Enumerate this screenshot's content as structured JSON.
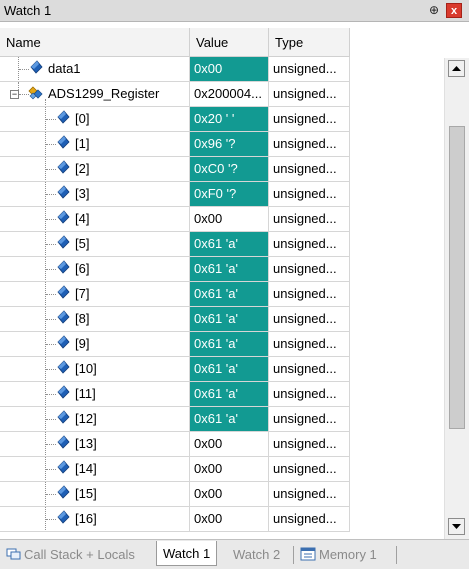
{
  "window": {
    "title": "Watch 1",
    "pin_icon": "pin-icon",
    "close_icon": "close-icon",
    "close_label": "x",
    "pin_glyph": "⊕"
  },
  "columns": {
    "name": "Name",
    "value": "Value",
    "type": "Type"
  },
  "colors": {
    "highlight": "#129a92",
    "variable_icon": "#1e5fb5"
  },
  "rows": [
    {
      "name": "data1",
      "value": "0x00",
      "type": "unsigned...",
      "changed": true,
      "level": 0,
      "icon": "variable-icon"
    },
    {
      "name": "ADS1299_Register",
      "value": "0x200004...",
      "type": "unsigned...",
      "changed": false,
      "level": 0,
      "icon": "struct-icon",
      "expanded": true
    },
    {
      "name": "[0]",
      "value": "0x20 ' '",
      "type": "unsigned...",
      "changed": true,
      "level": 1,
      "icon": "variable-icon"
    },
    {
      "name": "[1]",
      "value": "0x96 '?",
      "type": "unsigned...",
      "changed": true,
      "level": 1,
      "icon": "variable-icon"
    },
    {
      "name": "[2]",
      "value": "0xC0 '?",
      "type": "unsigned...",
      "changed": true,
      "level": 1,
      "icon": "variable-icon"
    },
    {
      "name": "[3]",
      "value": "0xF0 '?",
      "type": "unsigned...",
      "changed": true,
      "level": 1,
      "icon": "variable-icon"
    },
    {
      "name": "[4]",
      "value": "0x00",
      "type": "unsigned...",
      "changed": false,
      "level": 1,
      "icon": "variable-icon"
    },
    {
      "name": "[5]",
      "value": "0x61 'a'",
      "type": "unsigned...",
      "changed": true,
      "level": 1,
      "icon": "variable-icon"
    },
    {
      "name": "[6]",
      "value": "0x61 'a'",
      "type": "unsigned...",
      "changed": true,
      "level": 1,
      "icon": "variable-icon"
    },
    {
      "name": "[7]",
      "value": "0x61 'a'",
      "type": "unsigned...",
      "changed": true,
      "level": 1,
      "icon": "variable-icon"
    },
    {
      "name": "[8]",
      "value": "0x61 'a'",
      "type": "unsigned...",
      "changed": true,
      "level": 1,
      "icon": "variable-icon"
    },
    {
      "name": "[9]",
      "value": "0x61 'a'",
      "type": "unsigned...",
      "changed": true,
      "level": 1,
      "icon": "variable-icon"
    },
    {
      "name": "[10]",
      "value": "0x61 'a'",
      "type": "unsigned...",
      "changed": true,
      "level": 1,
      "icon": "variable-icon"
    },
    {
      "name": "[11]",
      "value": "0x61 'a'",
      "type": "unsigned...",
      "changed": true,
      "level": 1,
      "icon": "variable-icon"
    },
    {
      "name": "[12]",
      "value": "0x61 'a'",
      "type": "unsigned...",
      "changed": true,
      "level": 1,
      "icon": "variable-icon"
    },
    {
      "name": "[13]",
      "value": "0x00",
      "type": "unsigned...",
      "changed": false,
      "level": 1,
      "icon": "variable-icon"
    },
    {
      "name": "[14]",
      "value": "0x00",
      "type": "unsigned...",
      "changed": false,
      "level": 1,
      "icon": "variable-icon"
    },
    {
      "name": "[15]",
      "value": "0x00",
      "type": "unsigned...",
      "changed": false,
      "level": 1,
      "icon": "variable-icon"
    },
    {
      "name": "[16]",
      "value": "0x00",
      "type": "unsigned...",
      "changed": false,
      "level": 1,
      "icon": "variable-icon"
    }
  ],
  "scrollbar": {
    "up_icon": "scroll-up-icon",
    "down_icon": "scroll-down-icon"
  },
  "tabs": [
    {
      "label": "Call Stack + Locals",
      "icon": "call-stack-icon",
      "active": false
    },
    {
      "label": "Watch 1",
      "active": true
    },
    {
      "label": "Watch 2",
      "active": false
    },
    {
      "label": "Memory 1",
      "icon": "memory-icon",
      "active": false
    }
  ]
}
